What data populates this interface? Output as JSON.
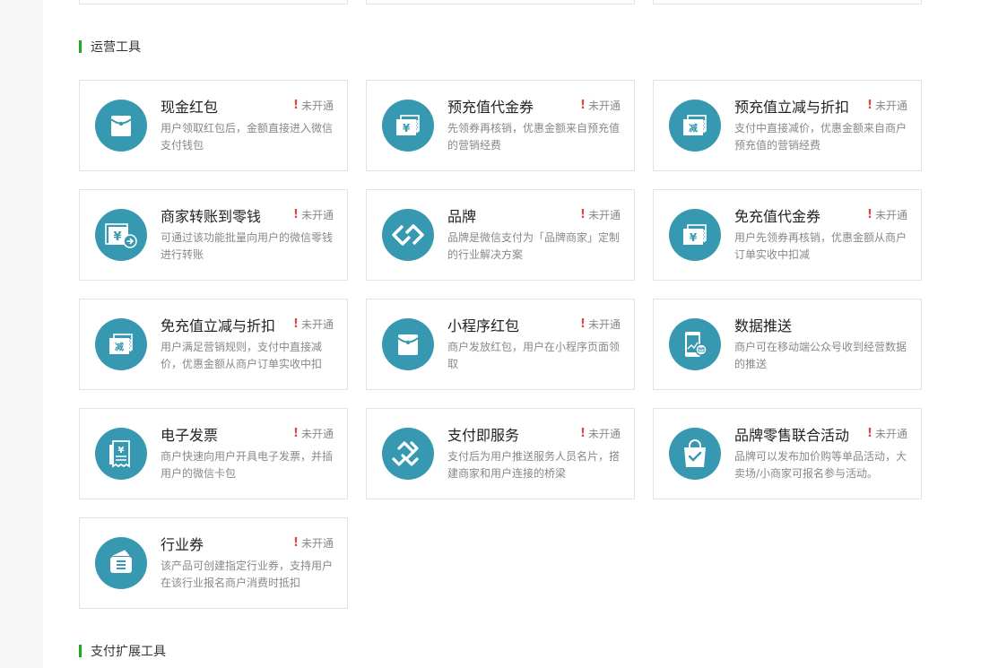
{
  "sections": [
    {
      "title": "运营工具"
    },
    {
      "title": "支付扩展工具"
    }
  ],
  "colors": {
    "accent": "#1aad19",
    "icon_bg": "#3798b2",
    "warning": "#e64340"
  },
  "tools": [
    {
      "title": "现金红包",
      "status": "未开通",
      "desc": "用户领取红包后，金额直接进入微信支付钱包",
      "icon": "red-packet-icon"
    },
    {
      "title": "预充值代金券",
      "status": "未开通",
      "desc": "先领券再核销，优惠金额来自预充值的营销经费",
      "icon": "yuan-coupon-icon"
    },
    {
      "title": "预充值立减与折扣",
      "status": "未开通",
      "desc": "支付中直接减价，优惠金额来自商户预充值的营销经费",
      "icon": "discount-coupon-icon"
    },
    {
      "title": "商家转账到零钱",
      "status": "未开通",
      "desc": "可通过该功能批量向用户的微信零钱进行转账",
      "icon": "transfer-icon"
    },
    {
      "title": "品牌",
      "status": "未开通",
      "desc": "品牌是微信支付为「品牌商家」定制的行业解决方案",
      "icon": "brand-icon"
    },
    {
      "title": "免充值代金券",
      "status": "未开通",
      "desc": "用户先领券再核销，优惠金额从商户订单实收中扣减",
      "icon": "yuan-coupon-icon"
    },
    {
      "title": "免充值立减与折扣",
      "status": "未开通",
      "desc": "用户满足营销规则，支付中直接减价，优惠金额从商户订单实收中扣",
      "icon": "discount-coupon-icon"
    },
    {
      "title": "小程序红包",
      "status": "未开通",
      "desc": "商户发放红包，用户在小程序页面领取",
      "icon": "red-packet-icon"
    },
    {
      "title": "数据推送",
      "status": "",
      "desc": "商户可在移动端公众号收到经营数据的推送",
      "icon": "data-push-icon"
    },
    {
      "title": "电子发票",
      "status": "未开通",
      "desc": "商户快速向用户开具电子发票，并插用户的微信卡包",
      "icon": "invoice-icon"
    },
    {
      "title": "支付即服务",
      "status": "未开通",
      "desc": "支付后为用户推送服务人员名片，搭建商家和用户连接的桥梁",
      "icon": "service-icon"
    },
    {
      "title": "品牌零售联合活动",
      "status": "未开通",
      "desc": "品牌可以发布加价购等单品活动，大卖场/小商家可报名参与活动。",
      "icon": "shopping-bag-icon"
    },
    {
      "title": "行业券",
      "status": "未开通",
      "desc": "该产品可创建指定行业券，支持用户在该行业报名商户消费时抵扣",
      "icon": "industry-coupon-icon"
    }
  ]
}
